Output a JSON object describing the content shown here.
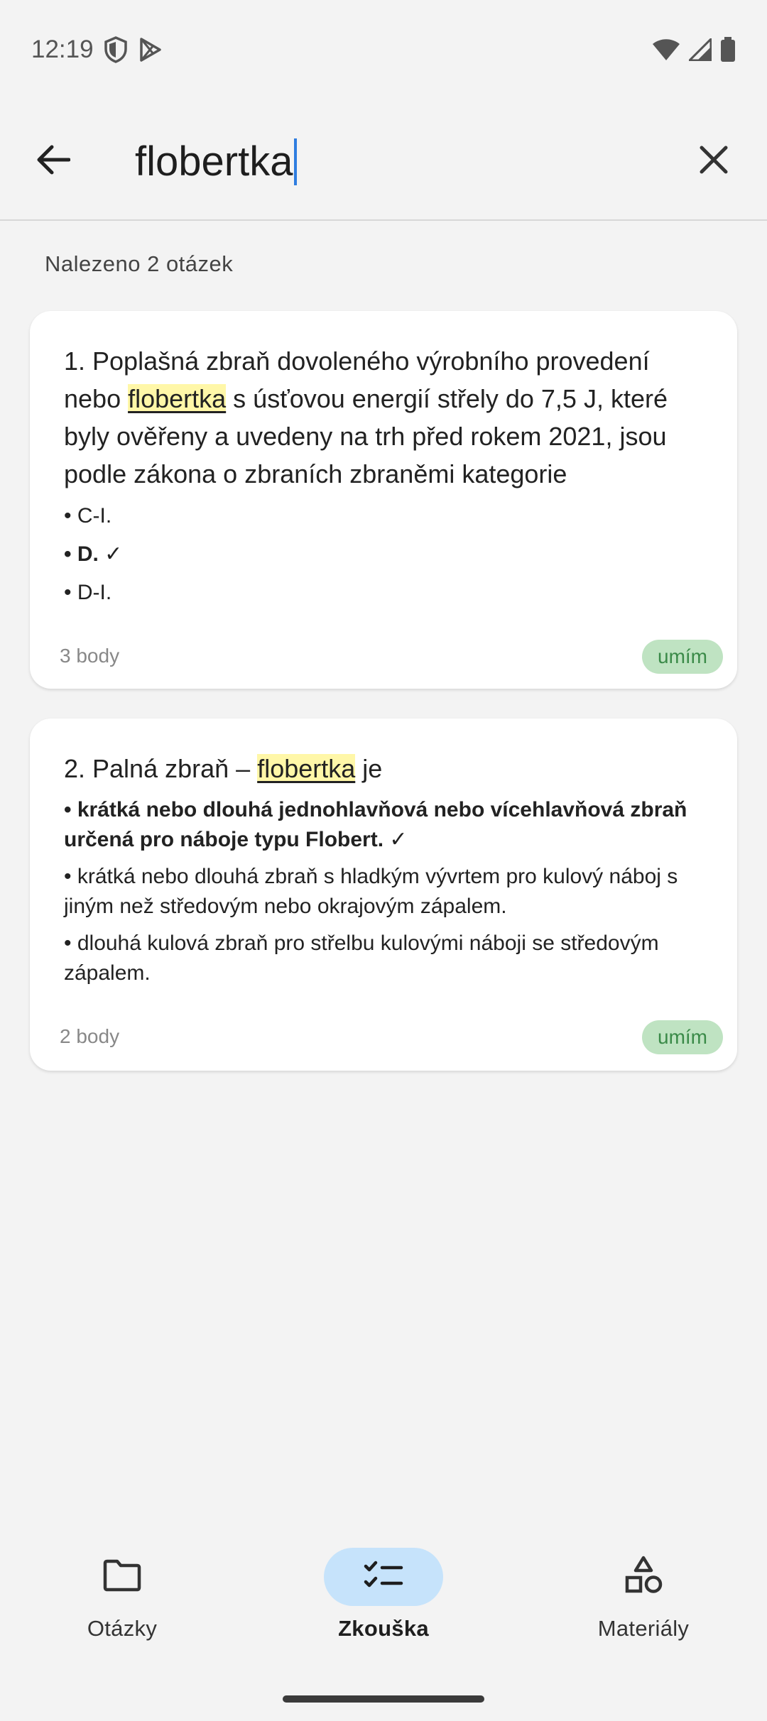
{
  "status_bar": {
    "time": "12:19"
  },
  "search": {
    "query": "flobertka"
  },
  "results": {
    "count_text": "Nalezeno 2 otázek",
    "items": [
      {
        "question_prefix": "1. Poplašná zbraň dovoleného výrobního provedení nebo ",
        "highlight": "flobertka",
        "question_suffix": " s úsťovou energií střely do 7,5 J, které byly ověřeny a uvedeny na trh před rokem 2021, jsou podle zákona o zbraních zbraněmi kategorie",
        "answers": [
          {
            "text": "• C-I.",
            "correct": false
          },
          {
            "text": "• D. ✓",
            "correct": true
          },
          {
            "text": "• D-I.",
            "correct": false
          }
        ],
        "points": "3 body",
        "badge": "umím"
      },
      {
        "question_prefix": "2. Palná zbraň – ",
        "highlight": "flobertka",
        "question_suffix": " je",
        "answers": [
          {
            "text": "• krátká nebo dlouhá jednohlavňová nebo vícehlavňová zbraň určená pro náboje typu Flobert. ✓",
            "correct": true
          },
          {
            "text": "• krátká nebo dlouhá zbraň s hladkým vývrtem pro kulový náboj s jiným než středovým nebo okrajovým zápalem.",
            "correct": false
          },
          {
            "text": "• dlouhá kulová zbraň pro střelbu kulovými náboji se středovým zápalem.",
            "correct": false
          }
        ],
        "points": "2 body",
        "badge": "umím"
      }
    ]
  },
  "bottom_nav": {
    "items": [
      {
        "label": "Otázky",
        "icon": "folder-icon",
        "active": false
      },
      {
        "label": "Zkouška",
        "icon": "checklist-icon",
        "active": true
      },
      {
        "label": "Materiály",
        "icon": "shapes-icon",
        "active": false
      }
    ]
  },
  "colors": {
    "accent": "#2f7de0",
    "highlight": "#fff7a8",
    "badge_bg": "#bfe3c2",
    "badge_text": "#3a8a48",
    "active_pill": "#c6e3fb"
  }
}
